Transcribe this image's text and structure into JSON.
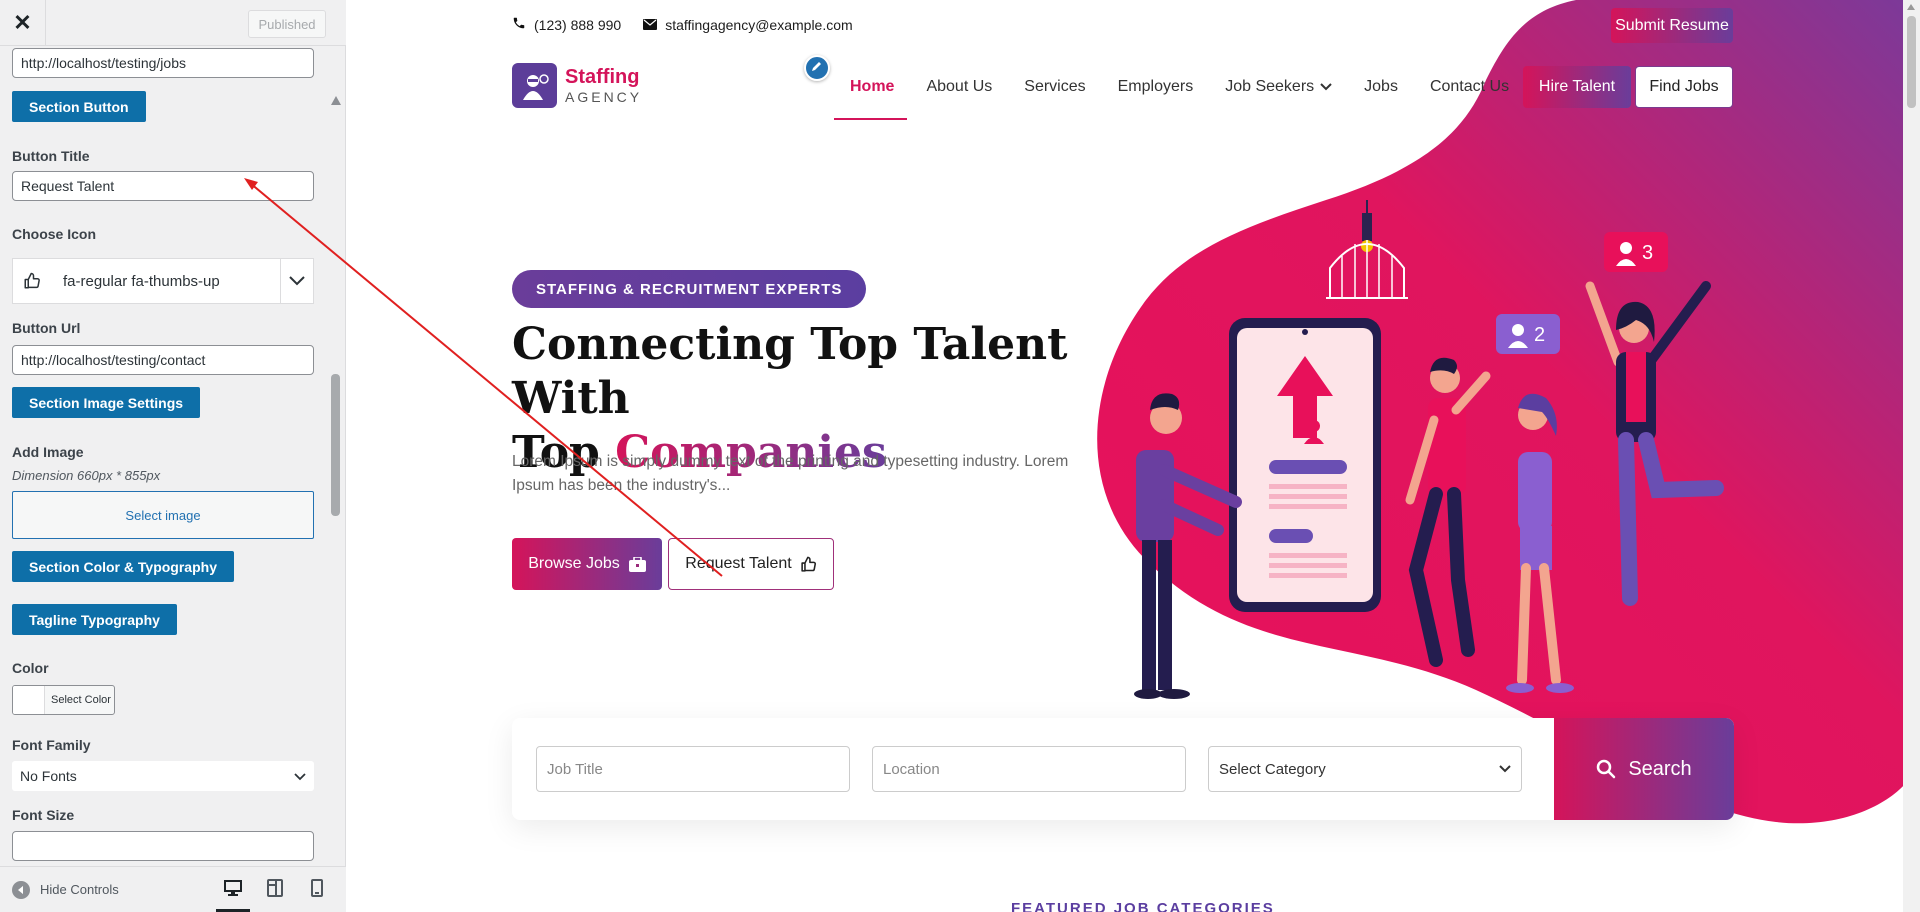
{
  "sidebar": {
    "published_label": "Published",
    "section_url_value": "http://localhost/testing/jobs",
    "section_button_label": "Section Button",
    "button_title_label": "Button Title",
    "button_title_value": "Request Talent",
    "choose_icon_label": "Choose Icon",
    "icon_value": "fa-regular fa-thumbs-up",
    "button_url_label": "Button Url",
    "button_url_value": "http://localhost/testing/contact",
    "section_image_settings_label": "Section Image Settings",
    "add_image_label": "Add Image",
    "dimension_text": "Dimension 660px * 855px",
    "select_image_label": "Select image",
    "section_color_typography_label": "Section Color & Typography",
    "tagline_typography_label": "Tagline Typography",
    "color_label": "Color",
    "select_color_label": "Select Color",
    "font_family_label": "Font Family",
    "font_family_value": "No Fonts",
    "font_size_label": "Font Size",
    "font_size_value": "",
    "hide_controls_label": "Hide Controls"
  },
  "site": {
    "phone": "(123) 888 990",
    "email": "staffingagency@example.com",
    "submit_resume": "Submit Resume",
    "logo_line1": "Staffing",
    "logo_line2": "AGENCY",
    "nav": [
      "Home",
      "About Us",
      "Services",
      "Employers",
      "Job Seekers",
      "Jobs",
      "Contact Us"
    ],
    "hire_talent": "Hire Talent",
    "find_jobs": "Find Jobs",
    "tagline": "STAFFING & RECRUITMENT EXPERTS",
    "title_part1": "Connecting Top Talent With",
    "title_part2": "Top ",
    "title_accent": "Companies",
    "description": "Lorem Ipsum is simply dummy text of the printing and typesetting industry. Lorem Ipsum has been the industry's...",
    "browse_jobs": "Browse Jobs",
    "request_talent": "Request Talent",
    "badge_3": "3",
    "badge_2": "2",
    "search": {
      "job_title_placeholder": "Job Title",
      "location_placeholder": "Location",
      "category_value": "Select Category",
      "button": "Search"
    },
    "featured_heading": "FEATURED JOB CATEGORIES"
  },
  "colors": {
    "brand_pink": "#d4145a",
    "brand_purple": "#6a3d9a",
    "wp_blue": "#0e6fa8"
  },
  "icons": {
    "close": "close-icon",
    "thumbs_up": "thumbs-up-icon",
    "briefcase": "briefcase-icon",
    "search": "search-icon",
    "phone": "phone-icon",
    "email": "envelope-icon",
    "pencil": "pencil-icon"
  }
}
